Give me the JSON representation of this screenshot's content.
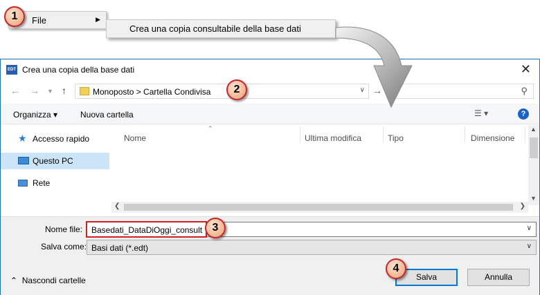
{
  "menu": {
    "file_label": "File",
    "submenu_item": "Crea una copia consultabile della base dati"
  },
  "steps": [
    "1",
    "2",
    "3",
    "4"
  ],
  "dialog": {
    "app_icon_text": "EDT",
    "title": "Crea una copia della base dati",
    "close_glyph": "✕",
    "address_path": "Monoposto > Cartella Condivisa",
    "toolbar": {
      "organize": "Organizza ▾",
      "new_folder": "Nuova cartella"
    },
    "sidebar": [
      {
        "label": "Accesso rapido",
        "icon": "star-icon"
      },
      {
        "label": "Questo PC",
        "icon": "computer-icon"
      },
      {
        "label": "Rete",
        "icon": "network-icon"
      }
    ],
    "columns": [
      "Nome",
      "Ultima modifica",
      "Tipo",
      "Dimensione"
    ],
    "file_name_label": "Nome file:",
    "file_name_value": "Basedati_DataDiOggi_consult",
    "save_as_label": "Salva come:",
    "save_as_value": "Basi dati (*.edt)",
    "hide_folders": "Nascondi cartelle",
    "save_button": "Salva",
    "cancel_button": "Annulla"
  },
  "colors": {
    "callout_border": "#c0282d",
    "highlight_border": "#d02020",
    "accent": "#0078d7"
  }
}
